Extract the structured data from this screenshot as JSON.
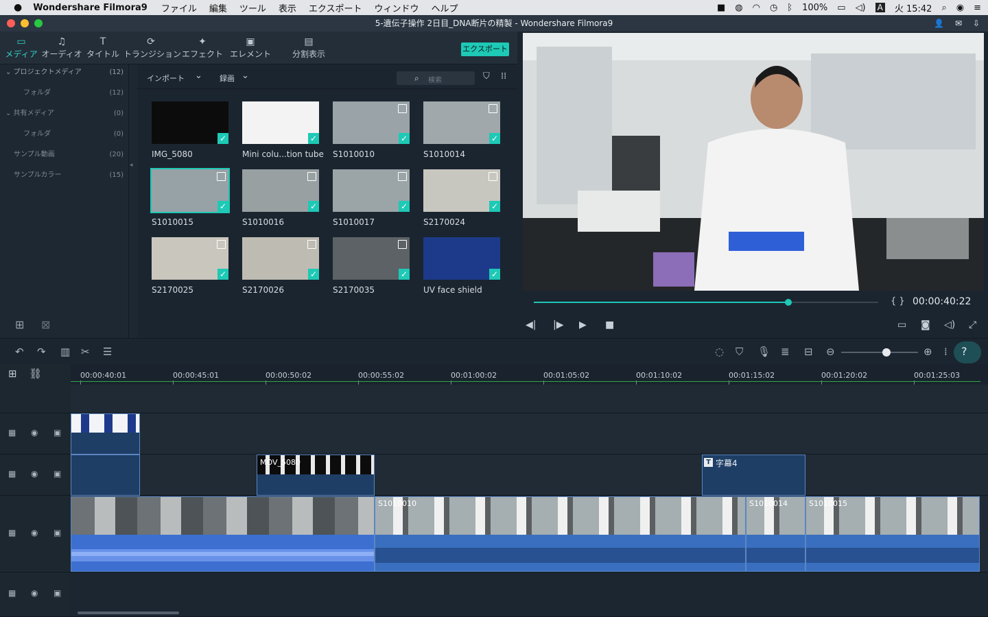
{
  "menubar": {
    "apple": "",
    "app": "Wondershare Filmora9",
    "items": [
      "ファイル",
      "編集",
      "ツール",
      "表示",
      "エクスポート",
      "ウィンドウ",
      "ヘルプ"
    ],
    "battery": "100%",
    "input": "A",
    "clock": "火 15:42"
  },
  "window": {
    "title": "5-遺伝子操作 2日目_DNA断片の精製 - Wondershare Filmora9"
  },
  "tabs": [
    {
      "label": "メディア",
      "icon": "▭"
    },
    {
      "label": "オーディオ",
      "icon": "♫"
    },
    {
      "label": "タイトル",
      "icon": "T"
    },
    {
      "label": "トランジション",
      "icon": "⟳"
    },
    {
      "label": "エフェクト",
      "icon": "✦"
    },
    {
      "label": "エレメント",
      "icon": "▣"
    },
    {
      "label": "分割表示",
      "icon": "▤"
    }
  ],
  "export_label": "エクスポート",
  "sidebar": [
    {
      "label": "⌄ プロジェクトメディア",
      "count": "(12)"
    },
    {
      "label": "フォルダ",
      "count": "(12)"
    },
    {
      "label": "⌄ 共有メディア",
      "count": "(0)"
    },
    {
      "label": "フォルダ",
      "count": "(0)"
    },
    {
      "label": "サンプル動画",
      "count": "(20)"
    },
    {
      "label": "サンプルカラー",
      "count": "(15)"
    }
  ],
  "media_toolbar": {
    "import": "インポート",
    "record": "録画",
    "search_placeholder": "検索"
  },
  "media_items": [
    {
      "name": "IMG_5080",
      "color": "#0c0c0c"
    },
    {
      "name": "Mini colu...tion tube",
      "color": "#f3f3f3"
    },
    {
      "name": "S1010010",
      "color": "#9aa4a8"
    },
    {
      "name": "S1010014",
      "color": "#a0a8ab"
    },
    {
      "name": "S1010015",
      "color": "#97a2a6"
    },
    {
      "name": "S1010016",
      "color": "#98a0a2"
    },
    {
      "name": "S1010017",
      "color": "#9ba4a7"
    },
    {
      "name": "S2170024",
      "color": "#c8c7bf"
    },
    {
      "name": "S2170025",
      "color": "#c9c6bd"
    },
    {
      "name": "S2170026",
      "color": "#bebcb2"
    },
    {
      "name": "S2170035",
      "color": "#5c6266"
    },
    {
      "name": "UV face shield",
      "color": "#1d3a8a"
    }
  ],
  "preview": {
    "timecode": "00:00:40:22",
    "progress": 0.74,
    "brackets": "{  }"
  },
  "timeline": {
    "ticks": [
      "00:00:40:01",
      "00:00:45:01",
      "00:00:50:02",
      "00:00:55:02",
      "00:01:00:02",
      "00:01:05:02",
      "00:01:10:02",
      "00:01:15:02",
      "00:01:20:02",
      "00:01:25:03"
    ],
    "zoom": 0.54
  },
  "clips": {
    "mov": "MOV_5080",
    "title": "字幕4",
    "s1": "S1010010",
    "s2": "S1010014",
    "s3": "S1010015"
  }
}
